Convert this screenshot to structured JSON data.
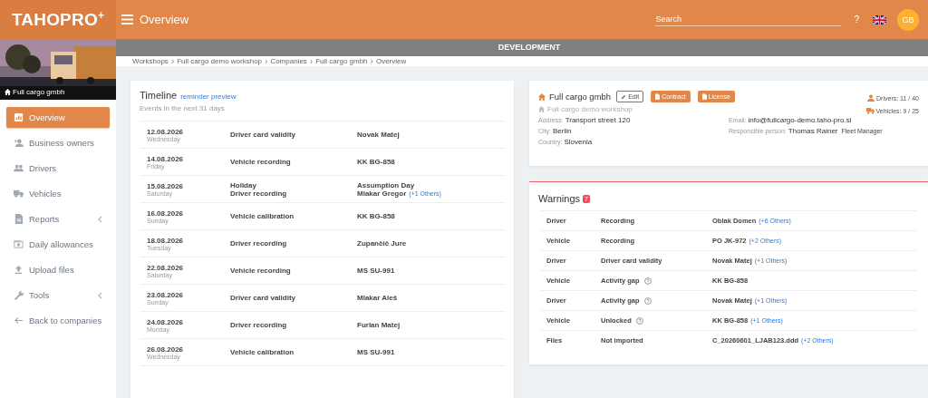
{
  "header": {
    "logo": "TAHOPRO",
    "logo_sup": "+",
    "page_title": "Overview",
    "search": {
      "placeholder": "Search"
    },
    "help": "?",
    "avatar": "GB"
  },
  "env_banner": "DEVELOPMENT",
  "sidebar": {
    "company": "Full cargo gmbh",
    "items": [
      {
        "label": "Overview",
        "selected": true,
        "submenu": false
      },
      {
        "label": "Business owners",
        "selected": false,
        "submenu": false
      },
      {
        "label": "Drivers",
        "selected": false,
        "submenu": false
      },
      {
        "label": "Vehicles",
        "selected": false,
        "submenu": false
      },
      {
        "label": "Reports",
        "selected": false,
        "submenu": true
      },
      {
        "label": "Daily allowances",
        "selected": false,
        "submenu": false
      },
      {
        "label": "Upload files",
        "selected": false,
        "submenu": false
      },
      {
        "label": "Tools",
        "selected": false,
        "submenu": true
      },
      {
        "label": "Back to companies",
        "selected": false,
        "submenu": false
      }
    ]
  },
  "breadcrumb": {
    "separator": "›",
    "items": [
      "Workshops",
      "Full cargo demo workshop",
      "Companies",
      "Full cargo gmbh",
      "Overview"
    ]
  },
  "timeline": {
    "title": "Timeline",
    "link": "reminder preview",
    "subtitle": "Events in the next 31 days",
    "rows": [
      {
        "date": "12.08.2026",
        "weekday": "Wednesday",
        "events": [
          {
            "type": "Driver card validity",
            "subject": "Novak Matej"
          }
        ]
      },
      {
        "date": "14.08.2026",
        "weekday": "Friday",
        "events": [
          {
            "type": "Vehicle recording",
            "subject": "KK BG-858"
          }
        ]
      },
      {
        "date": "15.08.2026",
        "weekday": "Saturday",
        "events": [
          {
            "type": "Holiday",
            "subject": "Assumption Day"
          },
          {
            "type": "Driver recording",
            "subject": "Mlakar Gregor",
            "others": "(+1 Others)"
          }
        ]
      },
      {
        "date": "16.08.2026",
        "weekday": "Sunday",
        "events": [
          {
            "type": "Vehicle calibration",
            "subject": "KK BG-858"
          }
        ]
      },
      {
        "date": "18.08.2026",
        "weekday": "Tuesday",
        "events": [
          {
            "type": "Driver recording",
            "subject": "Zupančič Jure"
          }
        ]
      },
      {
        "date": "22.08.2026",
        "weekday": "Saturday",
        "events": [
          {
            "type": "Vehicle recording",
            "subject": "MS SU-991"
          }
        ]
      },
      {
        "date": "23.08.2026",
        "weekday": "Sunday",
        "events": [
          {
            "type": "Driver card validity",
            "subject": "Mlakar Aleš"
          }
        ]
      },
      {
        "date": "24.08.2026",
        "weekday": "Monday",
        "events": [
          {
            "type": "Driver recording",
            "subject": "Furlan Matej"
          }
        ]
      },
      {
        "date": "26.08.2026",
        "weekday": "Wednesday",
        "events": [
          {
            "type": "Vehicle calibration",
            "subject": "MS SU-991"
          }
        ]
      }
    ]
  },
  "company": {
    "name": "Full cargo gmbh",
    "edit": "Edit",
    "buttons": [
      "Contract",
      "License"
    ],
    "workshop": "Full cargo demo workshop",
    "stats": [
      "Drivers: 11 / 40",
      "Vehicles: 9 / 25"
    ],
    "fields_left": [
      {
        "label": "Address:",
        "value": "Transport street 120"
      },
      {
        "label": "City:",
        "value": "Berlin"
      },
      {
        "label": "Country:",
        "value": "Slovenia"
      }
    ],
    "fields_right": [
      {
        "label": "Email:",
        "value": "info@fullcargo-demo.taho-pro.si"
      },
      {
        "label": "Responsible person:",
        "value": "Thomas Rainer",
        "note": "Fleet Manager"
      }
    ]
  },
  "warnings": {
    "title": "Warnings",
    "count": "7",
    "rows": [
      {
        "category": "Driver",
        "type": "Recording",
        "help": false,
        "subject": "Oblak Domen",
        "others": "(+6 Others)"
      },
      {
        "category": "Vehicle",
        "type": "Recording",
        "help": false,
        "subject": "PO JK-972",
        "others": "(+2 Others)"
      },
      {
        "category": "Driver",
        "type": "Driver card validity",
        "help": false,
        "subject": "Novak Matej",
        "others": "(+1 Others)"
      },
      {
        "category": "Vehicle",
        "type": "Activity gap",
        "help": true,
        "subject": "KK BG-858"
      },
      {
        "category": "Driver",
        "type": "Activity gap",
        "help": true,
        "subject": "Novak Matej",
        "others": "(+1 Others)"
      },
      {
        "category": "Vehicle",
        "type": "Unlocked",
        "help": true,
        "subject": "KK BG-858",
        "others": "(+1 Others)"
      },
      {
        "category": "Files",
        "type": "Not imported",
        "help": false,
        "subject": "C_20260601_LJAB123.ddd",
        "others": "(+2 Others)"
      }
    ]
  }
}
